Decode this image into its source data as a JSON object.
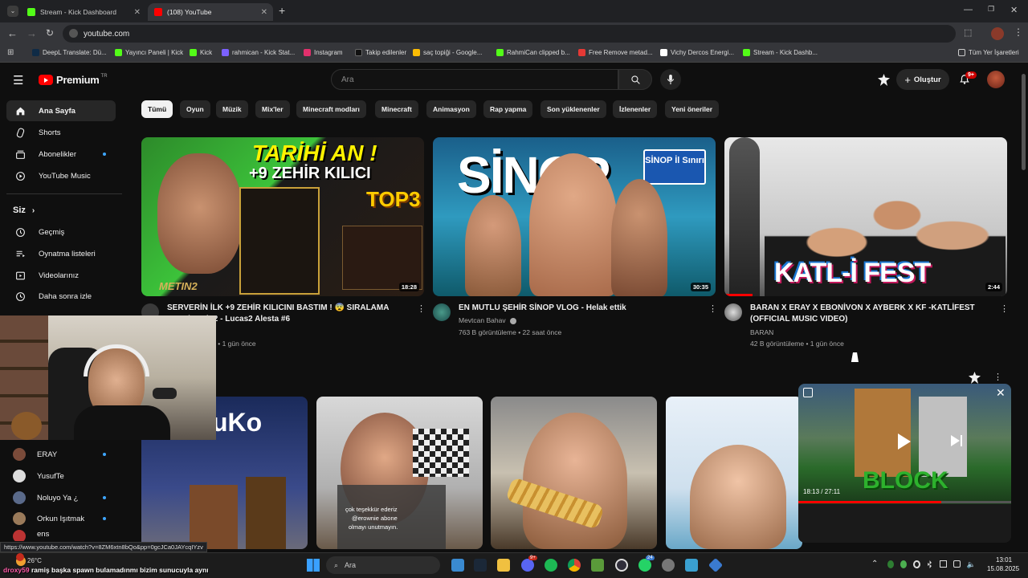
{
  "browser": {
    "tabs": [
      {
        "title": "Stream - Kick Dashboard",
        "color": "#53fc18"
      },
      {
        "title": "(108) YouTube",
        "color": "#ff0000"
      }
    ],
    "url": "youtube.com",
    "bookmarks": [
      {
        "label": "DeepL Translate: Dü...",
        "color": "#0f2b46"
      },
      {
        "label": "Yayıncı Paneli | Kick",
        "color": "#53fc18"
      },
      {
        "label": "Kick",
        "color": "#53fc18"
      },
      {
        "label": "rahmican - Kick Stat...",
        "color": "#7b61ff"
      },
      {
        "label": "Instagram",
        "color": "#e1306c"
      },
      {
        "label": "Takip edilenler",
        "color": "#111111"
      },
      {
        "label": "saç topiği - Google...",
        "color": "#fbbc04"
      },
      {
        "label": "RahmiCan clipped b...",
        "color": "#53fc18"
      },
      {
        "label": "Free Remove metad...",
        "color": "#e53935"
      },
      {
        "label": "Vichy Dercos Energi...",
        "color": "#ffffff"
      },
      {
        "label": "Stream - Kick Dashb...",
        "color": "#53fc18"
      }
    ],
    "all_bookmarks": "Tüm Yer İşaretleri",
    "status_url": "https://www.youtube.com/watch?v=8ZM6xtn8bQo&pp=0gcJCa0JAYcqIYzv"
  },
  "youtube": {
    "logo_text": "Premium",
    "logo_sup": "TR",
    "search_placeholder": "Ara",
    "create_label": "Oluştur",
    "notif_badge": "9+",
    "sidebar": {
      "main": [
        {
          "label": "Ana Sayfa",
          "icon": "home-icon"
        },
        {
          "label": "Shorts",
          "icon": "shorts-icon"
        },
        {
          "label": "Abonelikler",
          "icon": "subscriptions-icon"
        },
        {
          "label": "YouTube Music",
          "icon": "music-icon"
        }
      ],
      "you_header": "Siz",
      "you": [
        {
          "label": "Geçmiş",
          "icon": "history-icon"
        },
        {
          "label": "Oynatma listeleri",
          "icon": "playlists-icon"
        },
        {
          "label": "Videolarınız",
          "icon": "your-videos-icon"
        },
        {
          "label": "Daha sonra izle",
          "icon": "watch-later-icon"
        }
      ],
      "subs": [
        {
          "label": "ERAY"
        },
        {
          "label": "YusufTe"
        },
        {
          "label": "Noluyo Ya ¿"
        },
        {
          "label": "Orkun Işıtmak"
        },
        {
          "label": "ens"
        }
      ]
    },
    "chips": [
      "Tümü",
      "Oyun",
      "Müzik",
      "Mix'ler",
      "Minecraft modları",
      "Minecraft",
      "Animasyon",
      "Rap yapma",
      "Son yüklenenler",
      "İzlenenler",
      "Yeni öneriler"
    ],
    "videos": [
      {
        "title_line1": "SERVERİN İLK +9 ZEHİR KILICINI BASTIM ! 😨 SIRALAMA",
        "title_line2": "...OR |  Metin2 - Lucas2 Alesta #6",
        "channel": "",
        "meta": "...me • 1 gün önce",
        "duration": "18:28",
        "thumb_text1": "TARİHİ AN !",
        "thumb_text2": "+9 ZEHİR KILICI",
        "thumb_text3": "TOP3",
        "thumb_text4": "METIN2"
      },
      {
        "title_line1": "EN MUTLU ŞEHİR SİNOP VLOG - Helak ettik",
        "title_line2": "",
        "channel": "Mevtcan Bahav",
        "meta": "763 B görüntüleme • 22 saat önce",
        "duration": "30:35",
        "thumb_text1": "SİNOP",
        "thumb_text2": "SİNOP İl Sınırı"
      },
      {
        "title_line1": "BARAN X ERAY X EBONİVON X AYBERK X KF -KATLİFEST",
        "title_line2": "(OFFICIAL MUSIC VIDEO)",
        "channel": "BARAN",
        "meta": "42 B görüntüleme • 1 gün önce",
        "duration": "2:44",
        "thumb_text1": "KATL-İ FEST"
      }
    ],
    "row2_thumb_text": "uKo",
    "row2_overlay": [
      "çok teşekkür ederiz",
      "@erownie abone",
      "olmayı unutmayın."
    ],
    "miniplayer": {
      "time": "18:13 / 27:11",
      "progress": 0.67,
      "thumb_text": "BLOCK"
    }
  },
  "stream_overlay": {
    "chat_user": "droxy59",
    "chat_text": "ramiş başka spawn bulamadınmı bizim sunucuyla aynı"
  },
  "taskbar": {
    "weather": "26°C",
    "search": "Ara",
    "time": "13:01",
    "date": "15.08.2025",
    "badges": {
      "discord": "9+",
      "whatsapp": "24"
    }
  }
}
